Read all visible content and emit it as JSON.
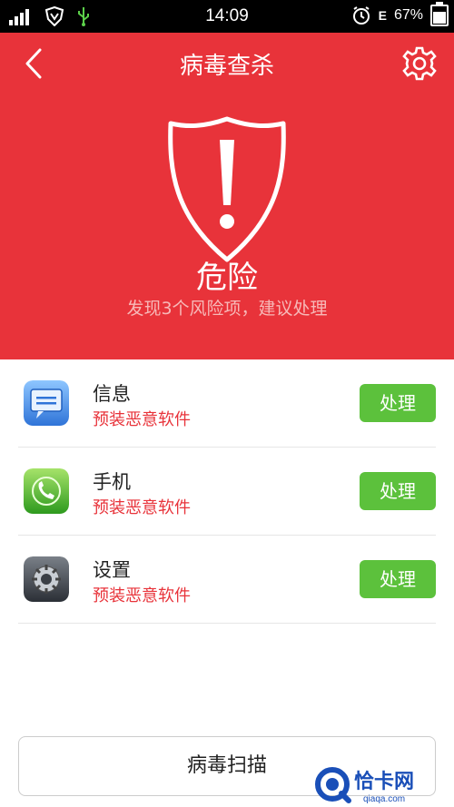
{
  "status_bar": {
    "time": "14:09",
    "battery": "67%",
    "battery_level": 0.67,
    "network_label": "E"
  },
  "header": {
    "title": "病毒查杀"
  },
  "status": {
    "title": "危险",
    "subtitle": "发现3个风险项，建议处理"
  },
  "items": [
    {
      "name": "信息",
      "desc": "预装恶意软件",
      "action": "处理",
      "icon": "messages-app-icon"
    },
    {
      "name": "手机",
      "desc": "预装恶意软件",
      "action": "处理",
      "icon": "phone-app-icon"
    },
    {
      "name": "设置",
      "desc": "预装恶意软件",
      "action": "处理",
      "icon": "settings-app-icon"
    }
  ],
  "scan_button": {
    "label": "病毒扫描"
  },
  "watermark": {
    "main": "恰卡网",
    "sub": "qiaqa.com"
  },
  "colors": {
    "header_red": "#e8333a",
    "action_green": "#5cc13c",
    "warning_text": "#e8333a"
  }
}
